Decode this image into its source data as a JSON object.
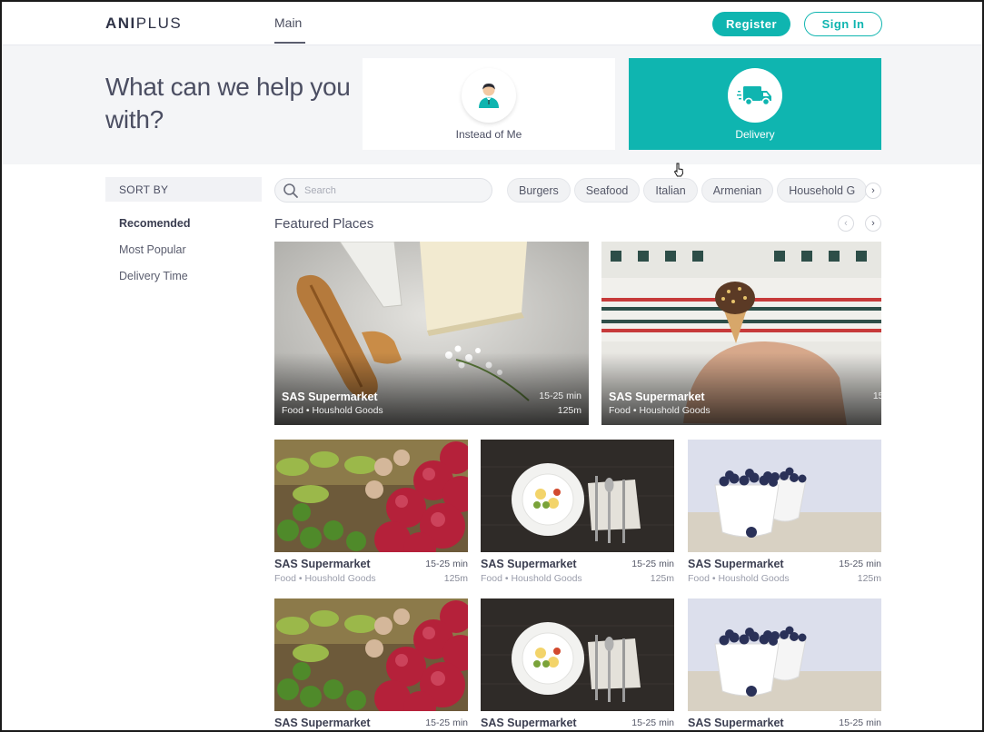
{
  "header": {
    "logo_bold": "ANI",
    "logo_light": "PLUS",
    "nav_main": "Main",
    "register_label": "Register",
    "signin_label": "Sign In"
  },
  "hero": {
    "title": "What can we help you with?",
    "options": [
      {
        "label": "Instead of Me",
        "icon": "person-icon",
        "selected": false
      },
      {
        "label": "Delivery",
        "icon": "delivery-truck-icon",
        "selected": true
      }
    ]
  },
  "sidebar": {
    "sort_by_label": "SORT BY",
    "items": [
      {
        "label": "Recomended",
        "active": true
      },
      {
        "label": "Most Popular",
        "active": false
      },
      {
        "label": "Delivery Time",
        "active": false
      }
    ]
  },
  "search": {
    "placeholder": "Search"
  },
  "categories": [
    "Burgers",
    "Seafood",
    "Italian",
    "Armenian",
    "Household G"
  ],
  "featured": {
    "title": "Featured Places",
    "items": [
      {
        "name": "SAS Supermarket",
        "tags": "Food • Houshold Goods",
        "time": "15-25 min",
        "distance": "125m",
        "image": "cheese-bread-photo"
      },
      {
        "name": "SAS Supermarket",
        "tags": "Food • Houshold Goods",
        "time": "15-",
        "distance": "",
        "image": "ice-cream-sweater-photo"
      }
    ]
  },
  "places": [
    {
      "name": "SAS Supermarket",
      "tags": "Food • Houshold Goods",
      "time": "15-25 min",
      "distance": "125m",
      "image": "produce-market-photo"
    },
    {
      "name": "SAS Supermarket",
      "tags": "Food • Houshold Goods",
      "time": "15-25 min",
      "distance": "125m",
      "image": "plated-dish-photo"
    },
    {
      "name": "SAS Supermarket",
      "tags": "Food • Houshold Goods",
      "time": "15-25 min",
      "distance": "125m",
      "image": "blueberries-bowls-photo"
    },
    {
      "name": "SAS Supermarket",
      "tags": "",
      "time": "15-25 min",
      "distance": "",
      "image": "produce-market-photo"
    },
    {
      "name": "SAS Supermarket",
      "tags": "",
      "time": "15-25 min",
      "distance": "",
      "image": "plated-dish-photo"
    },
    {
      "name": "SAS Supermarket",
      "tags": "",
      "time": "15-25 min",
      "distance": "",
      "image": "blueberries-bowls-photo"
    }
  ],
  "colors": {
    "accent": "#0fb5b0",
    "text_dark": "#3d4052",
    "hero_bg": "#f4f5f7"
  }
}
